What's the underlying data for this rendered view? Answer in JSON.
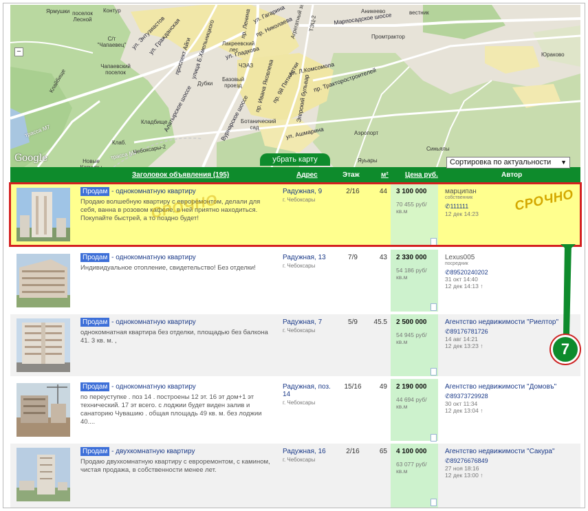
{
  "map": {
    "labels": {
      "yargushki": "Ярмушки",
      "posyolok_lesnoy": "поселок Лесной",
      "kontur": "Контур",
      "st_chapaevets": "С/т \"Чапаевец\"",
      "enthusiasts": "ул. Энтузиастов",
      "grazhdanskaya": "ул. Гражданская",
      "aigi": "проспект Айги",
      "khmelnitskogo": "улица Б.Хмельницкого",
      "lenina": "пр. Ленина",
      "gagarina": "ул. Гагарина",
      "nikolaeva": "пр. Николаева",
      "agregatny": "Агрегатный завод",
      "tets2": "ТЭЦ-2",
      "marposad": "Марпосадское шоссе",
      "anikeevo": "Аникеево",
      "vestnik": "вестник",
      "promtraktor": "Промтрактор",
      "chapaevskiy": "Чапаевский поселок",
      "lakeevsky": "Лакреевский лес",
      "gladkova": "ул. Гладкова",
      "chez": "ЧЭАЗ",
      "komsomola": "ул. Л.Комсомола",
      "traktorostroiteley": "пр. Тракторостроителей",
      "dubki": "Дубки",
      "bazovy": "Базовый проезд",
      "yakovleva": "пр. Ивана Яковлева",
      "egorsky": "Эгерский бульвар",
      "9pyatiletki": "пр. 9й Пятилетки",
      "kladbische": "Кладбище",
      "alatyrskoe": "Алатырское шоссе",
      "vurnarskoe": "Вурнарское шоссе",
      "botanichesky": "Ботанический сад",
      "ammanina": "ул. Ашмарина",
      "aeroport": "Аэропорт",
      "trassa_m7": "трасса М7",
      "trassa_m7b": "трасса М7",
      "klaybische2": "Клайбище",
      "klab": "Клаб.",
      "cheboksary2": "Чебоксары-2",
      "novye_karchury": "Новые Карчуры",
      "sinyaly": "Синьялы",
      "yaugary": "Яуьары",
      "yurkovo": "Юраково"
    },
    "zoom_out": "−",
    "google_logo": "Google"
  },
  "hide_map_label": "убрать карту",
  "sort": {
    "selected": "Сортировка по актуальности",
    "arrow": "▼"
  },
  "header": {
    "title": "Заголовок объявления (195)",
    "address": "Адрес",
    "floor": "Этаж",
    "area": "м²",
    "price": "Цена руб.",
    "author": "Автор"
  },
  "listings": [
    {
      "tag": "Продам",
      "title": " - однокомнатную квартиру",
      "description": "Продаю волшебную квартиру с евроремонтом, делали для себя, ванна в розовом кафеле, в ней приятно находиться. Покупайте быстрей, а то поздно будет!",
      "street": "Радужная, 9",
      "city": "г. Чебоксары",
      "floor": "2/16",
      "area": "44",
      "price": "3 100 000",
      "price_per_m": "70 455 руб/кв.м",
      "author": "марципан",
      "role": "собственник",
      "phone": "111111",
      "date1": "12 дек 14:23",
      "date2": "",
      "urgent": "СРОЧНО",
      "urgent_watermark": "СРОЧНО"
    },
    {
      "tag": "Продам",
      "title": " - однокомнатную квартиру",
      "description": "Индивидуальное отопление, свидетельство! Без отделки!",
      "street": "Радужная, 13",
      "city": "г. Чебоксары",
      "floor": "7/9",
      "area": "43",
      "price": "2 330 000",
      "price_per_m": "54 186 руб/кв.м",
      "author": "Lexus005",
      "role": "посредник",
      "phone": "89520240202",
      "date1": "31 окт 14:40",
      "date2": "12 дек 14:13 ↑"
    },
    {
      "tag": "Продам",
      "title": " - однокомнатную квартиру",
      "description": "однокомнатная квартира без отделки, площадью без балкона 41. 3 кв. м. ,",
      "street": "Радужная, 7",
      "city": "г. Чебоксары",
      "floor": "5/9",
      "area": "45.5",
      "price": "2 500 000",
      "price_per_m": "54 945 руб/кв.м",
      "author": "Агентство недвижимости \"Риелтор\"",
      "role": "",
      "phone": "89176781726",
      "date1": "14 авг 14:21",
      "date2": "12 дек 13:23 ↑"
    },
    {
      "tag": "Продам",
      "title": " - однокомнатную квартиру",
      "description": "по переуступке . поз 14 . построены 12 эт. 16 эт дом+1 эт технический. 17 эт всего. с лоджии будет виден залив и санаторию Чувашию . общая площадь 49 кв. м. без лоджии 40....",
      "street": "Радужная, поз. 14",
      "city": "г. Чебоксары",
      "floor": "15/16",
      "area": "49",
      "price": "2 190 000",
      "price_per_m": "44 694 руб/кв.м",
      "author": "Агентство недвижимости \"Домовъ\"",
      "role": "",
      "phone": "89373729928",
      "date1": "30 окт 11:34",
      "date2": "12 дек 13:04 ↑"
    },
    {
      "tag": "Продам",
      "title": " - двухкомнатную квартиру",
      "description": "Продаю двухкомнатную квартиру с евроремонтом, с камином, чистая продажа, в собственности менее лет.",
      "street": "Радужная, 16",
      "city": "г. Чебоксары",
      "floor": "2/16",
      "area": "65",
      "price": "4 100 000",
      "price_per_m": "63 077 руб/кв.м",
      "author": "Агентство недвижимости \"Сакура\"",
      "role": "",
      "phone": "89276676849",
      "date1": "27 ноя 18:16",
      "date2": "12 дек 13:00 ↑"
    }
  ],
  "phone_icon": "phone-icon",
  "callout_number": "7",
  "colors": {
    "header_green": "#0e8b2c",
    "highlight_yellow": "#ffff8e",
    "price_col_green": "#cdf2cd",
    "tag_blue": "#3d6fd8",
    "urgent_gold": "#d4a800",
    "highlight_border": "#d42020"
  }
}
